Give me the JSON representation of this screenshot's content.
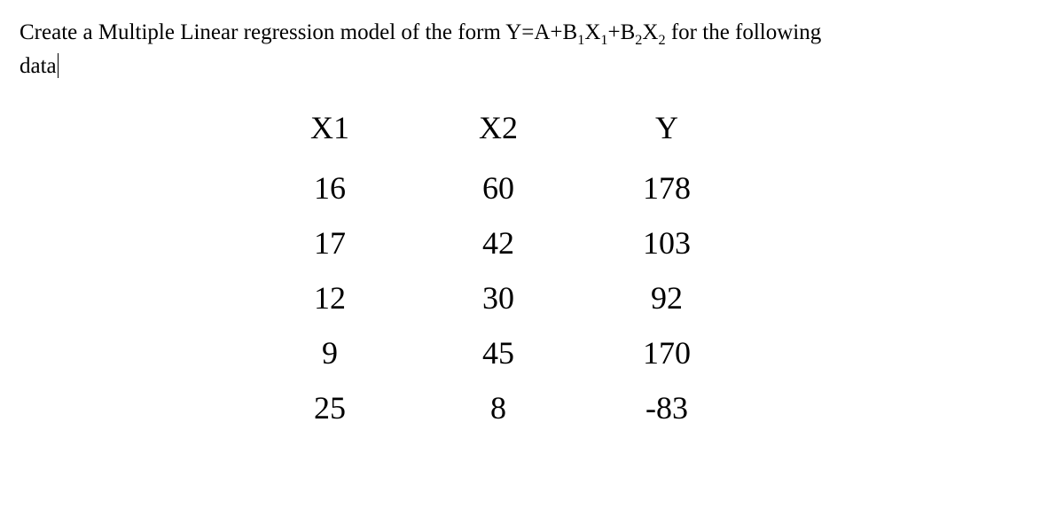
{
  "prompt": {
    "line1_prefix": "Create a Multiple Linear regression model of the form ",
    "equation_plain": "Y=A+B",
    "sub1": "1",
    "mid1": "X",
    "sub1b": "1",
    "plus": "+B",
    "sub2": "2",
    "mid2": "X",
    "sub2b": "2",
    "line1_suffix": " for the following",
    "line2": "data"
  },
  "chart_data": {
    "type": "table",
    "columns": [
      "X1",
      "X2",
      "Y"
    ],
    "rows": [
      {
        "x1": "16",
        "x2": "60",
        "y": "178"
      },
      {
        "x1": "17",
        "x2": "42",
        "y": "103"
      },
      {
        "x1": "12",
        "x2": "30",
        "y": "92"
      },
      {
        "x1": "9",
        "x2": "45",
        "y": "170"
      },
      {
        "x1": "25",
        "x2": "8",
        "y": "-83"
      }
    ]
  }
}
